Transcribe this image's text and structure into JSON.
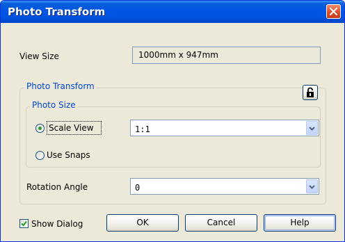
{
  "window": {
    "title": "Photo Transform"
  },
  "view_size": {
    "label": "View Size",
    "value": "1000mm x 947mm"
  },
  "photo_transform_group": {
    "legend": "Photo Transform",
    "lock_icon": "lock-icon",
    "photo_size_group": {
      "legend": "Photo Size",
      "scale_view": {
        "label": "Scale View",
        "checked": true
      },
      "use_snaps": {
        "label": "Use Snaps",
        "checked": false
      },
      "scale_combo": {
        "selected": "1:1"
      }
    },
    "rotation": {
      "label": "Rotation Angle",
      "selected": "0"
    }
  },
  "footer": {
    "show_dialog": {
      "label": "Show Dialog",
      "checked": true
    },
    "ok_label": "OK",
    "cancel_label": "Cancel",
    "help_label": "Help"
  },
  "colors": {
    "title_bar": "#0054e3",
    "dialog_background": "#ece9d8",
    "group_legend": "#0046d5",
    "close_button": "#e0522e",
    "radio_dot": "#2f9a2f"
  }
}
